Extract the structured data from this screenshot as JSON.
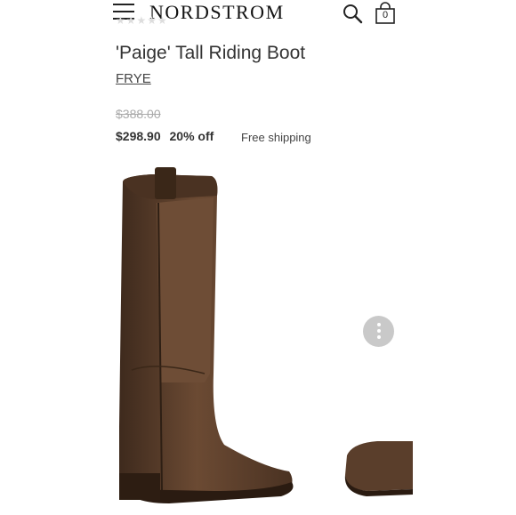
{
  "header": {
    "brand_logo": "NORDSTROM",
    "bag_count": "0",
    "icons": {
      "menu": "menu-icon",
      "search": "search-icon",
      "bag": "shopping-bag-icon"
    }
  },
  "product": {
    "title": "'Paige' Tall Riding Boot",
    "brand": "FRYE",
    "original_price": "$388.00",
    "sale_price": "$298.90",
    "discount": "20% off",
    "shipping": "Free shipping",
    "image_alt": "Brown leather tall riding boot"
  },
  "colors": {
    "boot_brown": "#5a3e2b",
    "text": "#333333",
    "muted": "#aaaaaa",
    "more_button": "#c9c9c9"
  }
}
